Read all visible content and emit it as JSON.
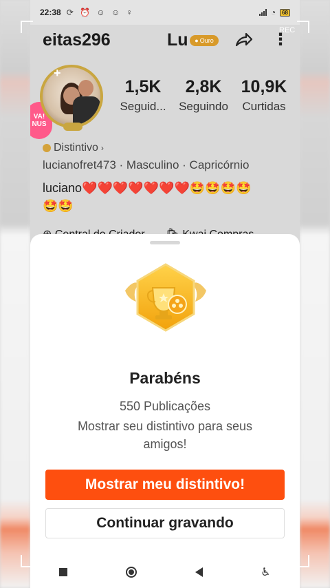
{
  "status_bar": {
    "time": "22:38",
    "battery": "68"
  },
  "profile": {
    "username": "eitas296",
    "display_name_partial": "Lu",
    "badge_label": "Ouro",
    "stats": [
      {
        "value": "1,5K",
        "label": "Seguid..."
      },
      {
        "value": "2,8K",
        "label": "Seguindo"
      },
      {
        "value": "10,9K",
        "label": "Curtidas"
      }
    ],
    "promo_bubble": [
      "VA!",
      "NUS"
    ],
    "badge_link": "Distintivo",
    "meta": "lucianofret473 · Masculino · Capricórnio",
    "bio_line1": "luciano❤️❤️❤️❤️❤️❤️❤️🤩🤩🤩🤩",
    "bio_line2": "🤩🤩",
    "creator_center": "Central do Criador",
    "kwai_shop": "Kwai Compras",
    "rec_label": "REC"
  },
  "sheet": {
    "title": "Parabéns",
    "count": "550 Publicações",
    "description": "Mostrar seu distintivo para seus amigos!",
    "primary_button": "Mostrar meu distintivo!",
    "secondary_button": "Continuar gravando"
  },
  "colors": {
    "accent": "#fe4f0f",
    "gold": "#f2b21c"
  }
}
